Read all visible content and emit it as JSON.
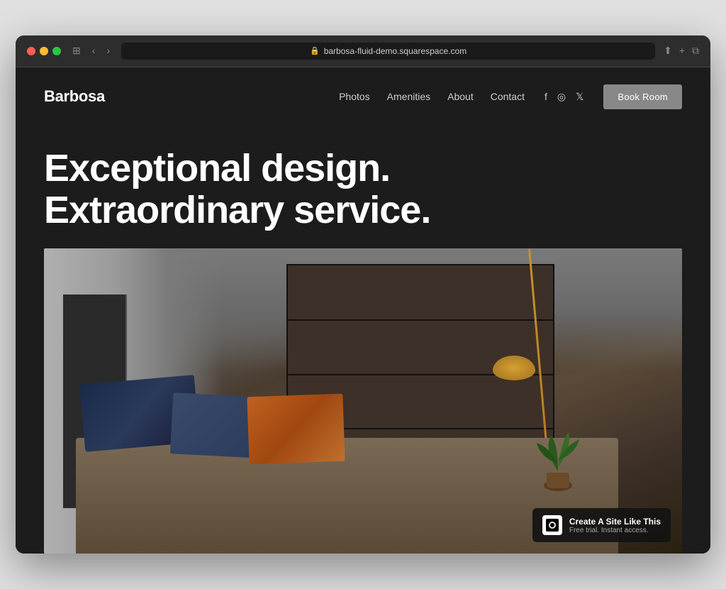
{
  "browser": {
    "url": "barbosa-fluid-demo.squarespace.com",
    "nav_back": "‹",
    "nav_forward": "›",
    "window_icon": "⊞"
  },
  "site": {
    "logo": "Barbosa",
    "nav": {
      "links": [
        {
          "label": "Photos",
          "href": "#"
        },
        {
          "label": "Amenities",
          "href": "#"
        },
        {
          "label": "About",
          "href": "#"
        },
        {
          "label": "Contact",
          "href": "#"
        }
      ],
      "social": [
        {
          "name": "facebook-icon",
          "glyph": "f"
        },
        {
          "name": "instagram-icon",
          "glyph": "◎"
        },
        {
          "name": "twitter-icon",
          "glyph": "𝕏"
        }
      ],
      "book_button": "Book Room"
    },
    "hero": {
      "headline_line1": "Exceptional design.",
      "headline_line2": "Extraordinary service."
    },
    "badge": {
      "main_text": "Create A Site Like This",
      "sub_text": "Free trial. Instant access."
    }
  }
}
